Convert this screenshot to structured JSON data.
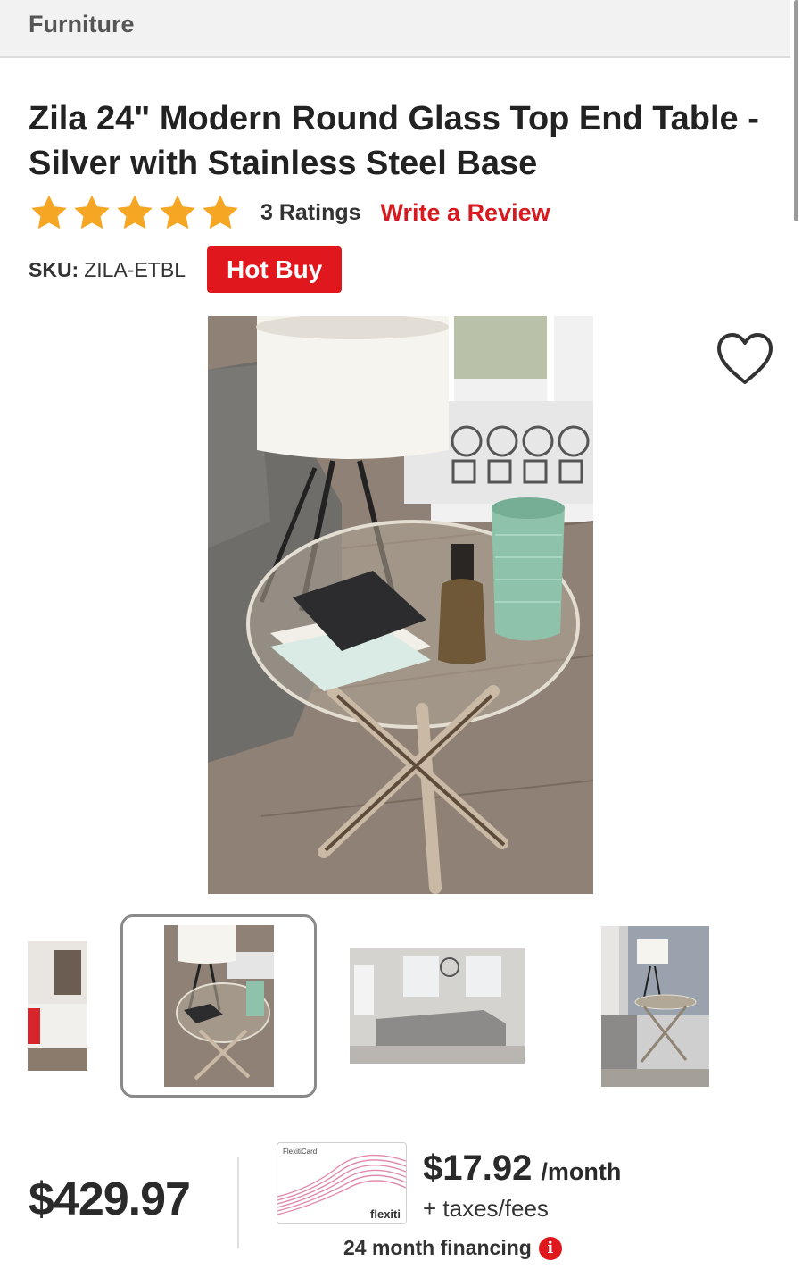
{
  "breadcrumb": {
    "label": "Furniture"
  },
  "product": {
    "title": "Zila 24\" Modern Round Glass Top End Table - Silver with Stainless Steel Base",
    "rating_stars": 5,
    "ratings_count": "3 Ratings",
    "write_review": "Write a Review",
    "sku_label": "SKU:",
    "sku_value": "ZILA-ETBL",
    "badge": "Hot Buy",
    "price": "$429.97"
  },
  "financing": {
    "card_brand": "FlexitiCard",
    "card_logo": "flexiti",
    "monthly_amount": "$17.92",
    "monthly_unit": "/month",
    "taxes_note": "+ taxes/fees",
    "term": "24 month financing"
  },
  "colors": {
    "accent_red": "#e1171e",
    "star": "#f5a623",
    "link_red": "#d71920"
  },
  "icons": {
    "heart": "heart-outline-icon",
    "info": "info-icon",
    "star": "star-icon"
  }
}
